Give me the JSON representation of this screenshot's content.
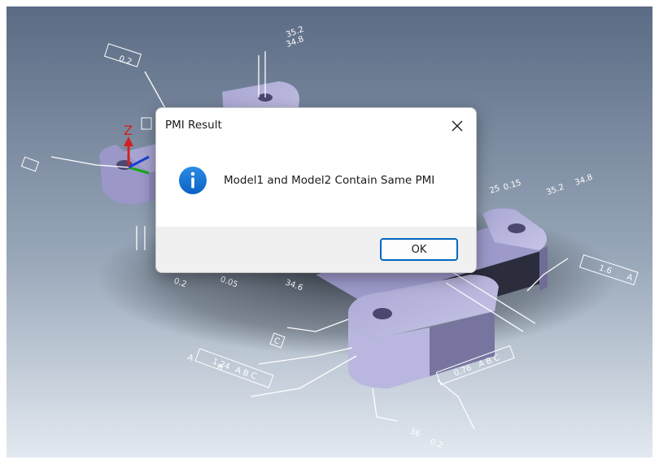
{
  "dialog": {
    "title": "PMI Result",
    "message": "Model1 and Model2 Contain Same PMI",
    "ok_label": "OK",
    "icon": "info-icon",
    "accent": "#0067c0"
  },
  "scene": {
    "background_top": "#5d6e87",
    "background_bottom": "#dfe6ee",
    "part_color": "#b7b5dc",
    "axis_label": "Z",
    "annotations": {
      "hole_top_1": "35.2",
      "hole_top_2": "34.8",
      "frame_top_left": "0.2",
      "dim_right_1": "25",
      "dim_right_1_tol": "0.15",
      "hole_right_1": "35.2",
      "hole_right_2": "34.8",
      "frame_right": "1.6",
      "frame_right_datum": "A",
      "frame_mid_tol": "0.76",
      "frame_mid_datums": "A B C",
      "frame_low_left": "1.24",
      "frame_low_left_datums": "A B C",
      "dim_bottom": "36",
      "dim_bottom_tol": "0.2",
      "dim_left_1": "0.2",
      "dim_left_2": "0.05",
      "dim_left_3": "34.6",
      "datum_a": "A",
      "datum_c": "C",
      "dim_left_arrow": "A",
      "dim_left_arrow_b": "B"
    }
  }
}
